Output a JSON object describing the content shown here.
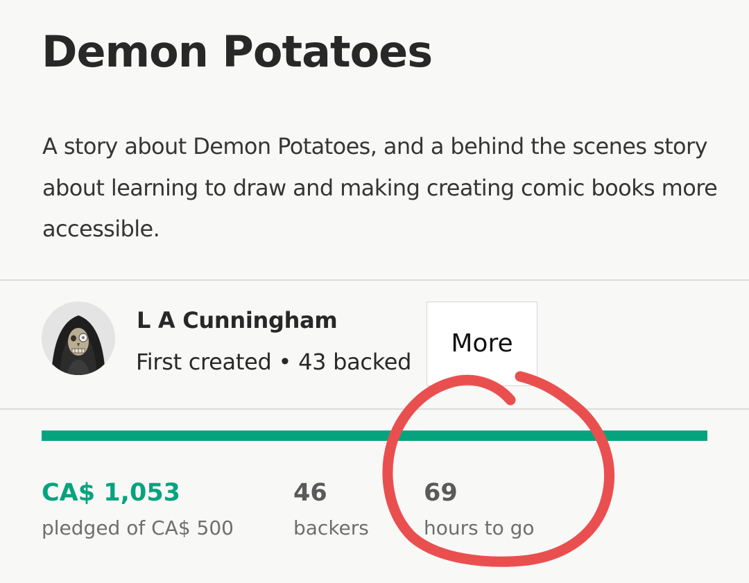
{
  "project": {
    "title": "Demon Potatoes",
    "blurb": "A story about Demon Potatoes, and a behind the scenes story about learning to draw and making creating comic books more accessible."
  },
  "creator": {
    "name": "L A Cunningham",
    "status": "First created",
    "separator": "•",
    "backed": "43 backed",
    "avatar_icon": "hooded-skull-avatar"
  },
  "more_button": {
    "label": "More"
  },
  "funding": {
    "progress_percent": 100,
    "pledged": "CA$ 1,053",
    "pledged_label": "pledged of CA$ 500",
    "backers": "46",
    "backers_label": "backers",
    "hours": "69",
    "hours_label": "hours to go"
  },
  "colors": {
    "accent_green": "#05a47e",
    "annotation_red": "#ea4f4f"
  }
}
